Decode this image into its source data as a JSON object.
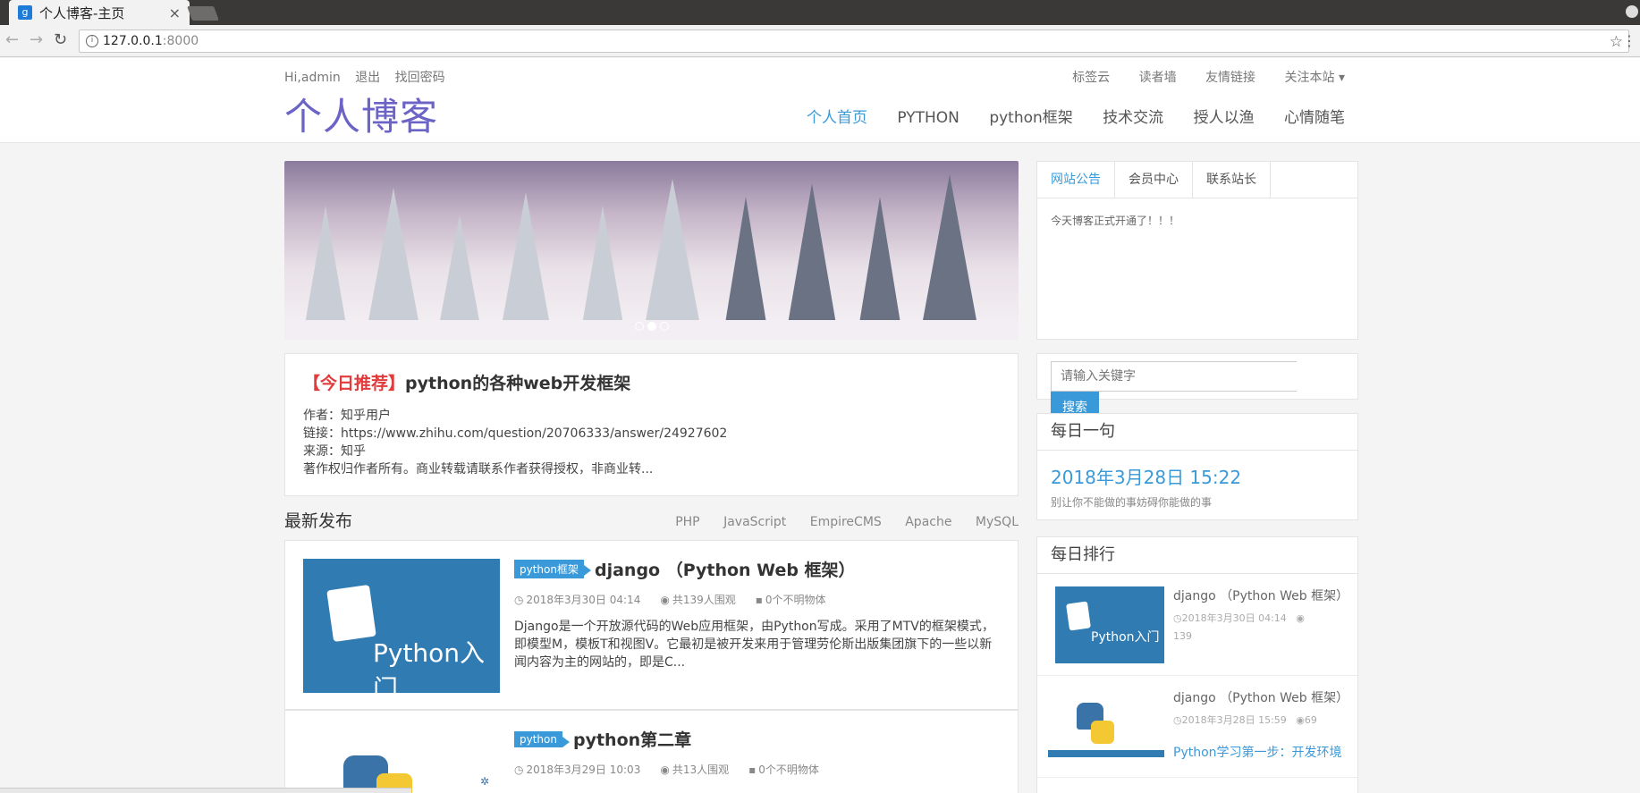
{
  "browser": {
    "tab_title": "个人博客-主页",
    "tab_close": "×",
    "favicon": "g",
    "url_host": "127.0.0.1",
    "url_port": ":8000"
  },
  "header": {
    "greeting": "Hi,admin",
    "logout": "退出",
    "recover": "找回密码",
    "top_links": [
      "标签云",
      "读者墙",
      "友情链接",
      "关注本站 ▾"
    ],
    "brand": "个人博客",
    "nav": [
      "个人首页",
      "PYTHON",
      "python框架",
      "技术交流",
      "授人以渔",
      "心情随笔"
    ]
  },
  "recommend": {
    "tag": "【今日推荐】",
    "title": "python的各种web开发框架",
    "lines": [
      "作者：知乎用户",
      "链接：https://www.zhihu.com/question/20706333/answer/24927602",
      "来源：知乎",
      "著作权归作者所有。商业转载请联系作者获得授权，非商业转..."
    ]
  },
  "latest": {
    "title": "最新发布",
    "tags": [
      "PHP",
      "JavaScript",
      "EmpireCMS",
      "Apache",
      "MySQL"
    ],
    "articles": [
      {
        "category": "python框架",
        "title": "django （Python Web 框架）",
        "date": "2018年3月30日 04:14",
        "views": "共139人围观",
        "comments": "0个不明物体",
        "thumb_text": "Python入门",
        "excerpt": "Django是一个开放源代码的Web应用框架，由Python写成。采用了MTV的框架模式，即模型M，模板T和视图V。它最初是被开发来用于管理劳伦斯出版集团旗下的一些以新闻内容为主的网站的，即是C..."
      },
      {
        "category": "python",
        "title": "python第二章",
        "date": "2018年3月29日 10:03",
        "views": "共13人围观",
        "comments": "0个不明物体"
      }
    ]
  },
  "sidebar": {
    "notice_tabs": [
      "网站公告",
      "会员中心",
      "联系站长"
    ],
    "notice_text": "今天博客正式开通了！！！",
    "search_placeholder": "请输入关键字",
    "search_button": "搜索",
    "daily_title": "每日一句",
    "daily_date": "2018年3月28日 15:22",
    "daily_quote": "别让你不能做的事妨碍你能做的事",
    "rank_title": "每日排行",
    "rank_items": [
      {
        "title": "django （Python Web 框架）",
        "date": "2018年3月30日 04:14",
        "views": "139",
        "thumb_text": "Python入门"
      },
      {
        "title": "django （Python Web 框架）",
        "date": "2018年3月28日 15:59",
        "views": "69"
      }
    ],
    "rank_peek_title": "Python学习第一步：开发环境"
  }
}
